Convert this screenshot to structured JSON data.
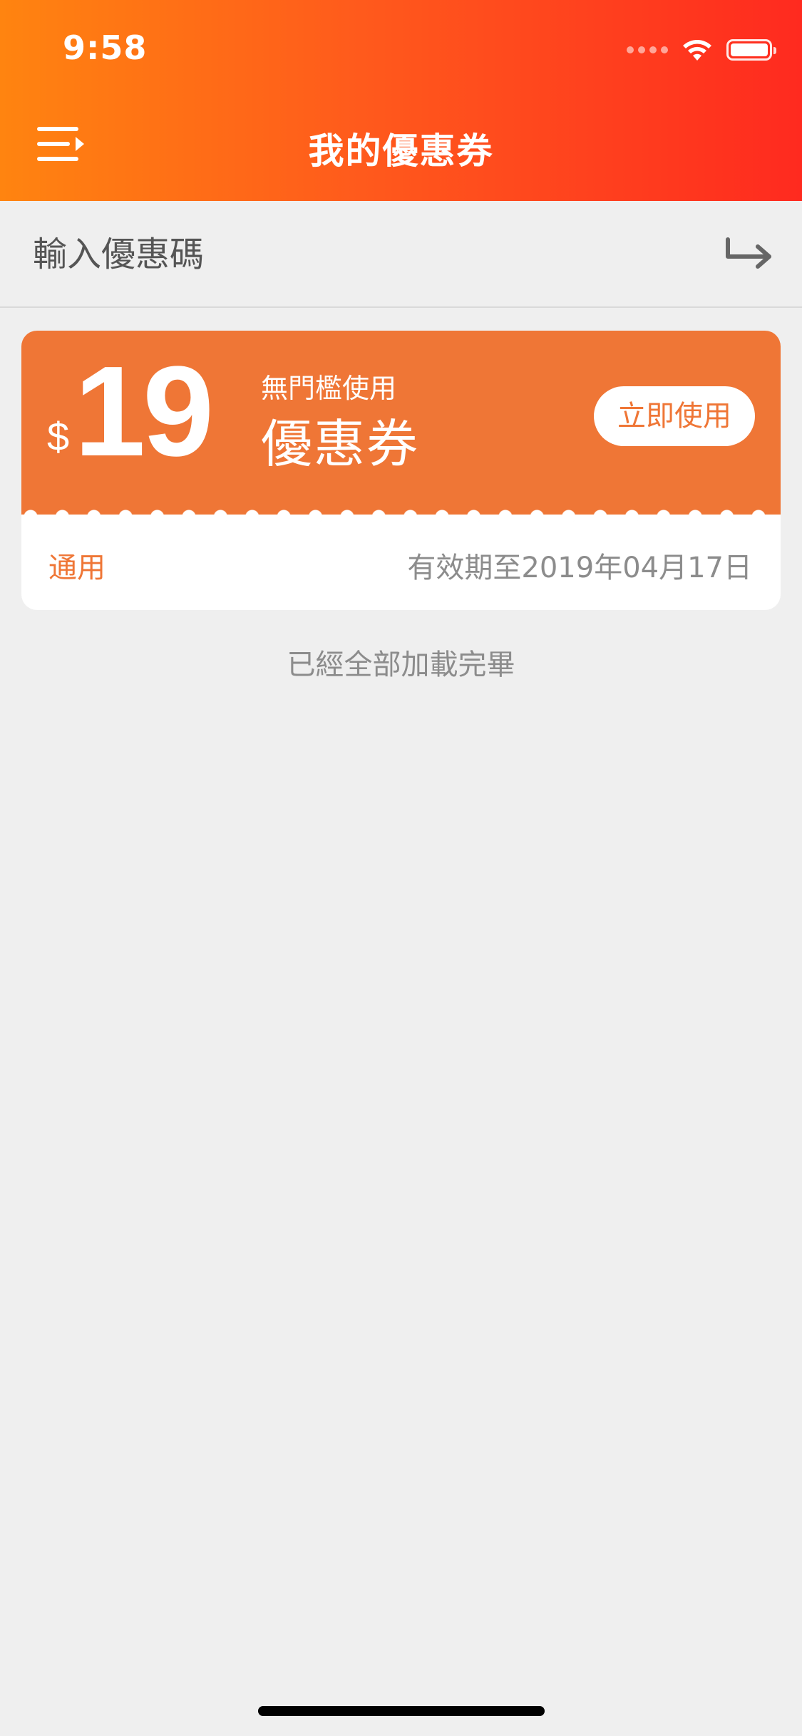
{
  "status_bar": {
    "time": "9:58"
  },
  "nav": {
    "title": "我的優惠券",
    "menu_icon": "menu-icon"
  },
  "promo": {
    "placeholder": "輸入優惠碼",
    "submit_icon": "redeem-arrow-icon"
  },
  "coupons": [
    {
      "currency": "$",
      "amount": "19",
      "condition": "無門檻使用",
      "type_label": "優惠券",
      "action_label": "立即使用",
      "scope": "通用",
      "expiry": "有效期至2019年04月17日"
    }
  ],
  "list_footer": "已經全部加載完畢",
  "colors": {
    "header_gradient_start": "#ff8410",
    "header_gradient_end": "#ff2a1f",
    "coupon_accent": "#ef7636",
    "background": "#efefef"
  }
}
